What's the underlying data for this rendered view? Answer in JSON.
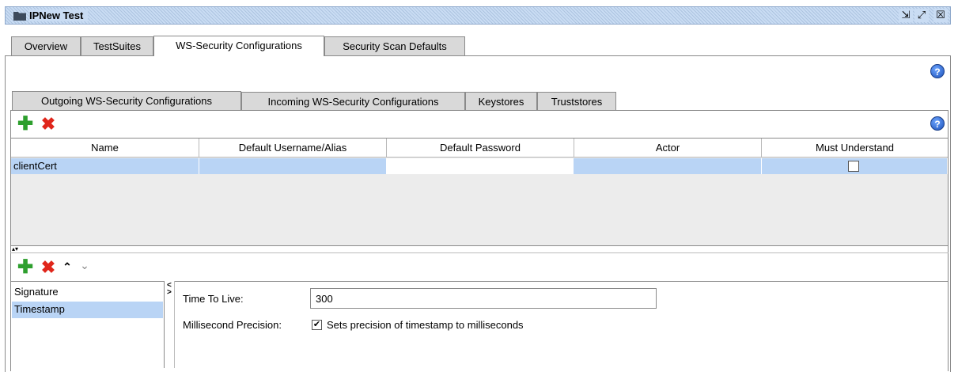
{
  "window": {
    "title": "IPNew Test",
    "buttons": {
      "restore": "⇲",
      "maximize": "⤢",
      "close": "☒"
    }
  },
  "outer_tabs": [
    {
      "label": "Overview",
      "active": false
    },
    {
      "label": "TestSuites",
      "active": false
    },
    {
      "label": "WS-Security Configurations",
      "active": true
    },
    {
      "label": "Security Scan Defaults",
      "active": false
    }
  ],
  "inner_tabs": [
    {
      "label": "Outgoing WS-Security Configurations",
      "active": true
    },
    {
      "label": "Incoming WS-Security Configurations",
      "active": false
    },
    {
      "label": "Keystores",
      "active": false
    },
    {
      "label": "Truststores",
      "active": false
    }
  ],
  "help_glyph": "?",
  "toolbar": {
    "add_glyph": "✚",
    "remove_glyph": "✖",
    "up_glyph": "⌃",
    "down_glyph": "⌄"
  },
  "table": {
    "columns": [
      "Name",
      "Default Username/Alias",
      "Default Password",
      "Actor",
      "Must Understand"
    ],
    "rows": [
      {
        "name": "clientCert",
        "username": "",
        "password": "",
        "actor": "",
        "must_understand": false
      }
    ]
  },
  "splitter_glyph": "▴▾",
  "entries": [
    {
      "label": "Signature",
      "selected": false
    },
    {
      "label": "Timestamp",
      "selected": true
    }
  ],
  "divider_glyphs": {
    "left": "<",
    "right": ">"
  },
  "timestamp": {
    "ttl_label": "Time To Live:",
    "ttl_value": "300",
    "precision_label": "Millisecond Precision:",
    "precision_checkbox_label": "Sets precision of timestamp to milliseconds",
    "precision_checked": true,
    "check_glyph": "✔"
  },
  "colors": {
    "selection": "#b9d4f5",
    "add_green": "#2e9f2e",
    "remove_red": "#e0261b",
    "title_bar": "#c9dcf3"
  }
}
